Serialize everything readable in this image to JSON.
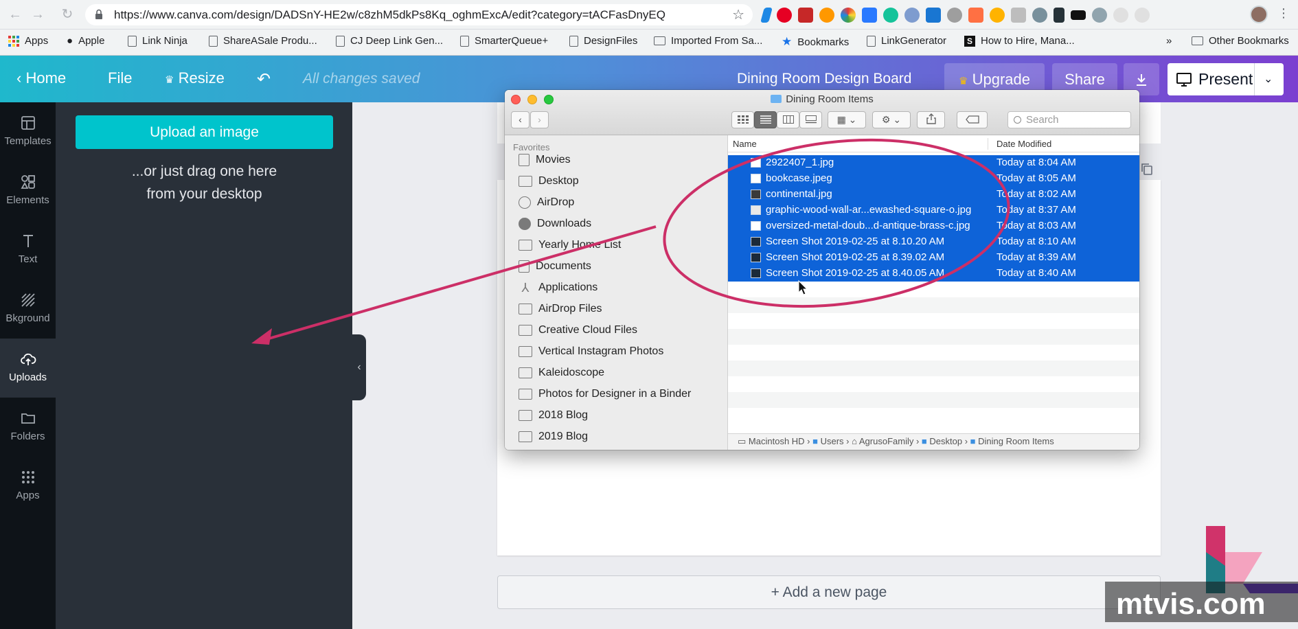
{
  "browser": {
    "url": "https://www.canva.com/design/DADSnY-HE2w/c8zhM5dkPs8Kq_oghmExcA/edit?category=tACFasDnyEQ",
    "bookmarks": [
      "Apps",
      "Apple",
      "Link Ninja",
      "ShareASale Produ...",
      "CJ Deep Link Gen...",
      "SmarterQueue+",
      "DesignFiles",
      "Imported From Sa...",
      "Bookmarks",
      "LinkGenerator",
      "How to Hire, Mana..."
    ],
    "overflow": "»",
    "other_bookmarks": "Other Bookmarks"
  },
  "canva_topbar": {
    "home": "Home",
    "file": "File",
    "resize": "Resize",
    "saved_status": "All changes saved",
    "design_title": "Dining Room Design Board",
    "upgrade": "Upgrade",
    "share": "Share",
    "present": "Present"
  },
  "rail": [
    "Templates",
    "Elements",
    "Text",
    "Bkground",
    "Uploads",
    "Folders",
    "Apps"
  ],
  "upload_panel": {
    "button": "Upload an image",
    "hint_line1": "...or just drag one here",
    "hint_line2": "from your desktop"
  },
  "canvas": {
    "add_page": "+ Add a new page"
  },
  "finder": {
    "title": "Dining Room Items",
    "search_placeholder": "Search",
    "favorites_label": "Favorites",
    "sidebar": [
      "Movies",
      "Desktop",
      "AirDrop",
      "Downloads",
      "Yearly Home List",
      "Documents",
      "Applications",
      "AirDrop Files",
      "Creative Cloud Files",
      "Vertical Instagram Photos",
      "Kaleidoscope",
      "Photos for Designer in a Binder",
      "2018 Blog",
      "2019 Blog"
    ],
    "columns": {
      "name": "Name",
      "date": "Date Modified"
    },
    "files": [
      {
        "name": "2922407_1.jpg",
        "date": "Today at 8:04 AM"
      },
      {
        "name": "bookcase.jpeg",
        "date": "Today at 8:05 AM"
      },
      {
        "name": "continental.jpg",
        "date": "Today at 8:02 AM"
      },
      {
        "name": "graphic-wood-wall-ar...ewashed-square-o.jpg",
        "date": "Today at 8:37 AM"
      },
      {
        "name": "oversized-metal-doub...d-antique-brass-c.jpg",
        "date": "Today at 8:03 AM"
      },
      {
        "name": "Screen Shot 2019-02-25 at 8.10.20 AM",
        "date": "Today at 8:10 AM"
      },
      {
        "name": "Screen Shot 2019-02-25 at 8.39.02 AM",
        "date": "Today at 8:39 AM"
      },
      {
        "name": "Screen Shot 2019-02-25 at 8.40.05 AM",
        "date": "Today at 8:40 AM"
      }
    ],
    "path": [
      "Macintosh HD",
      "Users",
      "AgrusoFamily",
      "Desktop",
      "Dining Room Items"
    ]
  },
  "watermark": "mtvis.com",
  "colors": {
    "selection": "#0e63d8",
    "annotation": "#cc2f67",
    "canva_teal": "#00c4cc"
  }
}
